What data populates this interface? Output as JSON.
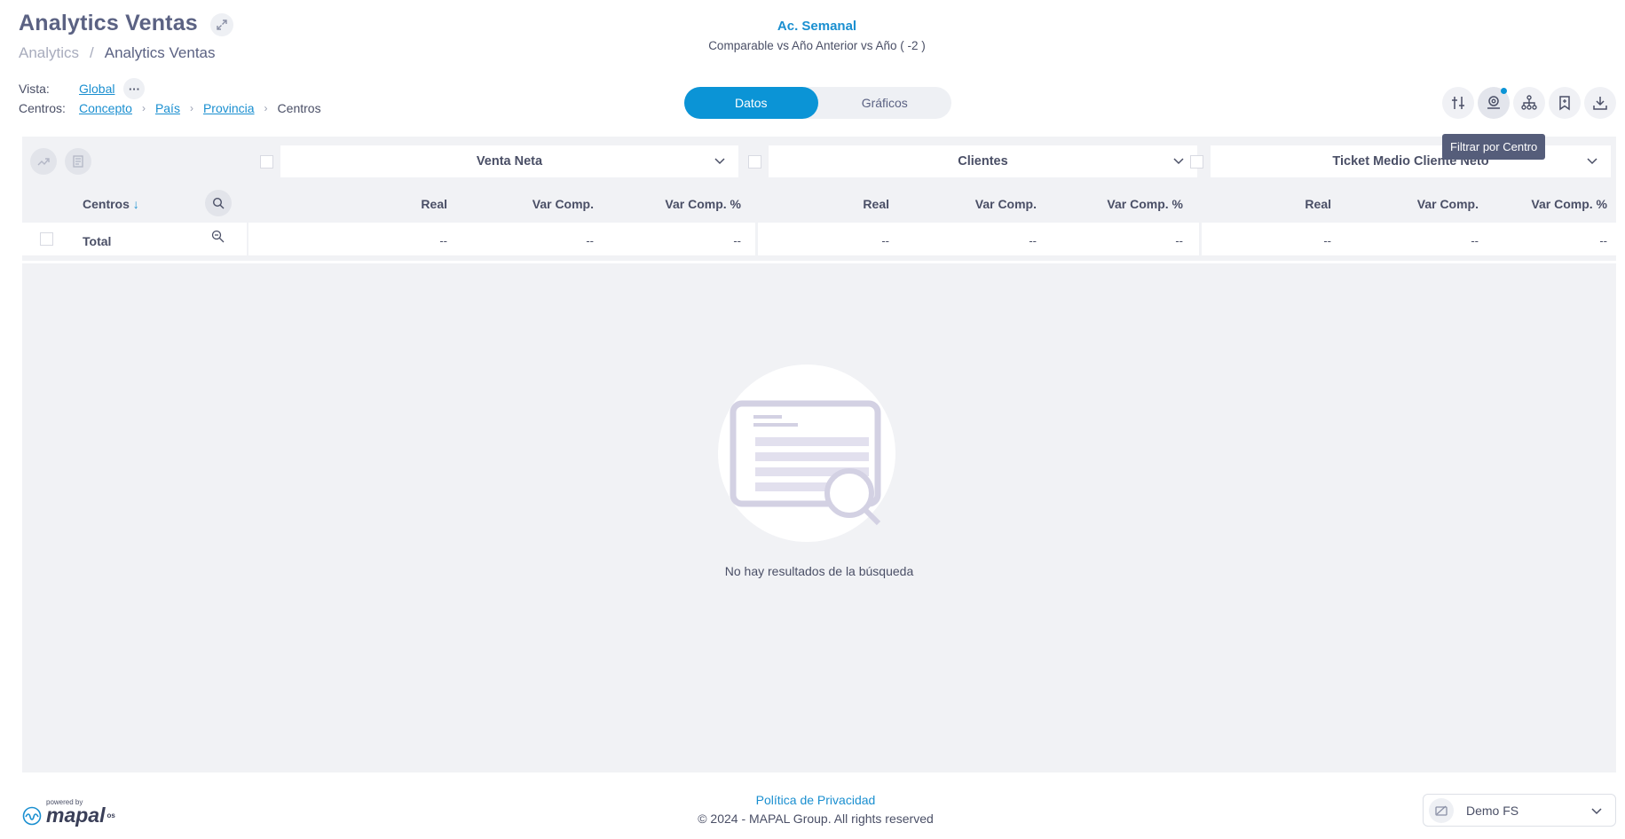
{
  "header": {
    "title": "Analytics Ventas",
    "breadcrumb": [
      {
        "label": "Analytics"
      },
      {
        "label": "Analytics Ventas"
      }
    ],
    "breadcrumb_sep": "/"
  },
  "vista": {
    "label": "Vista:",
    "value": "Global",
    "more": "···"
  },
  "centros": {
    "label": "Centros:",
    "path": [
      "Concepto",
      "País",
      "Provincia"
    ],
    "current": "Centros"
  },
  "period": {
    "title": "Ac. Semanal",
    "subtitle": "Comparable vs Año Anterior vs Año ( -2 )"
  },
  "view_toggle": {
    "options": [
      "Datos",
      "Gráficos"
    ],
    "active": "Datos"
  },
  "actions": {
    "tooltip": "Filtrar por Centro",
    "icons": [
      "adjust-icon",
      "location-filter-icon",
      "hierarchy-icon",
      "bookmark-icon",
      "download-icon"
    ]
  },
  "table": {
    "row_header": "Centros",
    "sort_arrow": "↓",
    "metrics": [
      {
        "label": "Venta Neta",
        "columns": [
          "Real",
          "Var Comp.",
          "Var Comp. %"
        ],
        "total": [
          "--",
          "--",
          "--"
        ]
      },
      {
        "label": "Clientes",
        "columns": [
          "Real",
          "Var Comp.",
          "Var Comp. %"
        ],
        "total": [
          "--",
          "--",
          "--"
        ]
      },
      {
        "label": "Ticket Medio Cliente Neto",
        "columns": [
          "Real",
          "Var Comp.",
          "Var Comp. %"
        ],
        "total": [
          "--",
          "--",
          "--"
        ]
      }
    ],
    "total_label": "Total",
    "empty_message": "No hay resultados de la búsqueda"
  },
  "footer": {
    "powered_by": "powered by",
    "brand": "mapal",
    "brand_suffix": "os",
    "privacy": "Política de Privacidad",
    "copyright": "© 2024 - MAPAL Group. All rights reserved",
    "org": "Demo FS"
  },
  "colors": {
    "accent": "#0b94d6",
    "link": "#1a8fd0",
    "panel": "#f1f2f5",
    "title": "#5b6283"
  }
}
